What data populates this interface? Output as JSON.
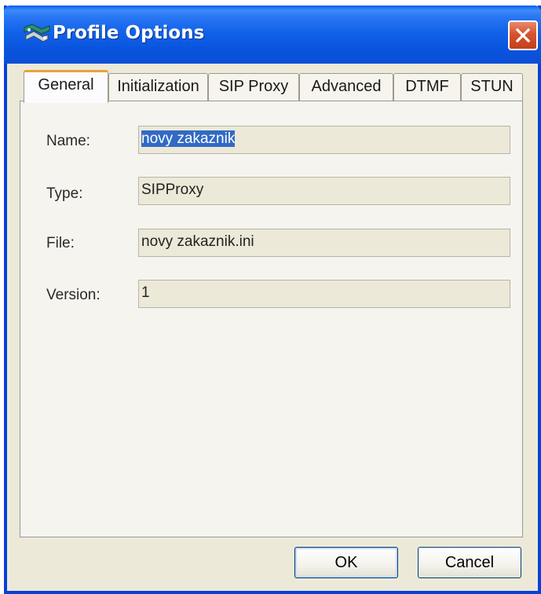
{
  "window": {
    "title": "Profile Options",
    "icon": "network-phone-icon",
    "close_icon": "close-icon",
    "colors": {
      "titlebar": "#0a54dd",
      "frame": "#0841d6",
      "face": "#ece9d8",
      "close": "#d6532d",
      "tab_highlight": "#e8a33b",
      "selection": "#316ac5"
    }
  },
  "tabs": [
    {
      "label": "General",
      "selected": true
    },
    {
      "label": "Initialization",
      "selected": false
    },
    {
      "label": "SIP Proxy",
      "selected": false
    },
    {
      "label": "Advanced",
      "selected": false
    },
    {
      "label": "DTMF",
      "selected": false
    },
    {
      "label": "STUN",
      "selected": false
    }
  ],
  "general": {
    "name_label": "Name:",
    "name_value": "novy zakaznik",
    "type_label": "Type:",
    "type_value": "SIPProxy",
    "file_label": "File:",
    "file_value": "novy zakaznik.ini",
    "version_label": "Version:",
    "version_value": "1"
  },
  "buttons": {
    "ok": "OK",
    "cancel": "Cancel"
  }
}
